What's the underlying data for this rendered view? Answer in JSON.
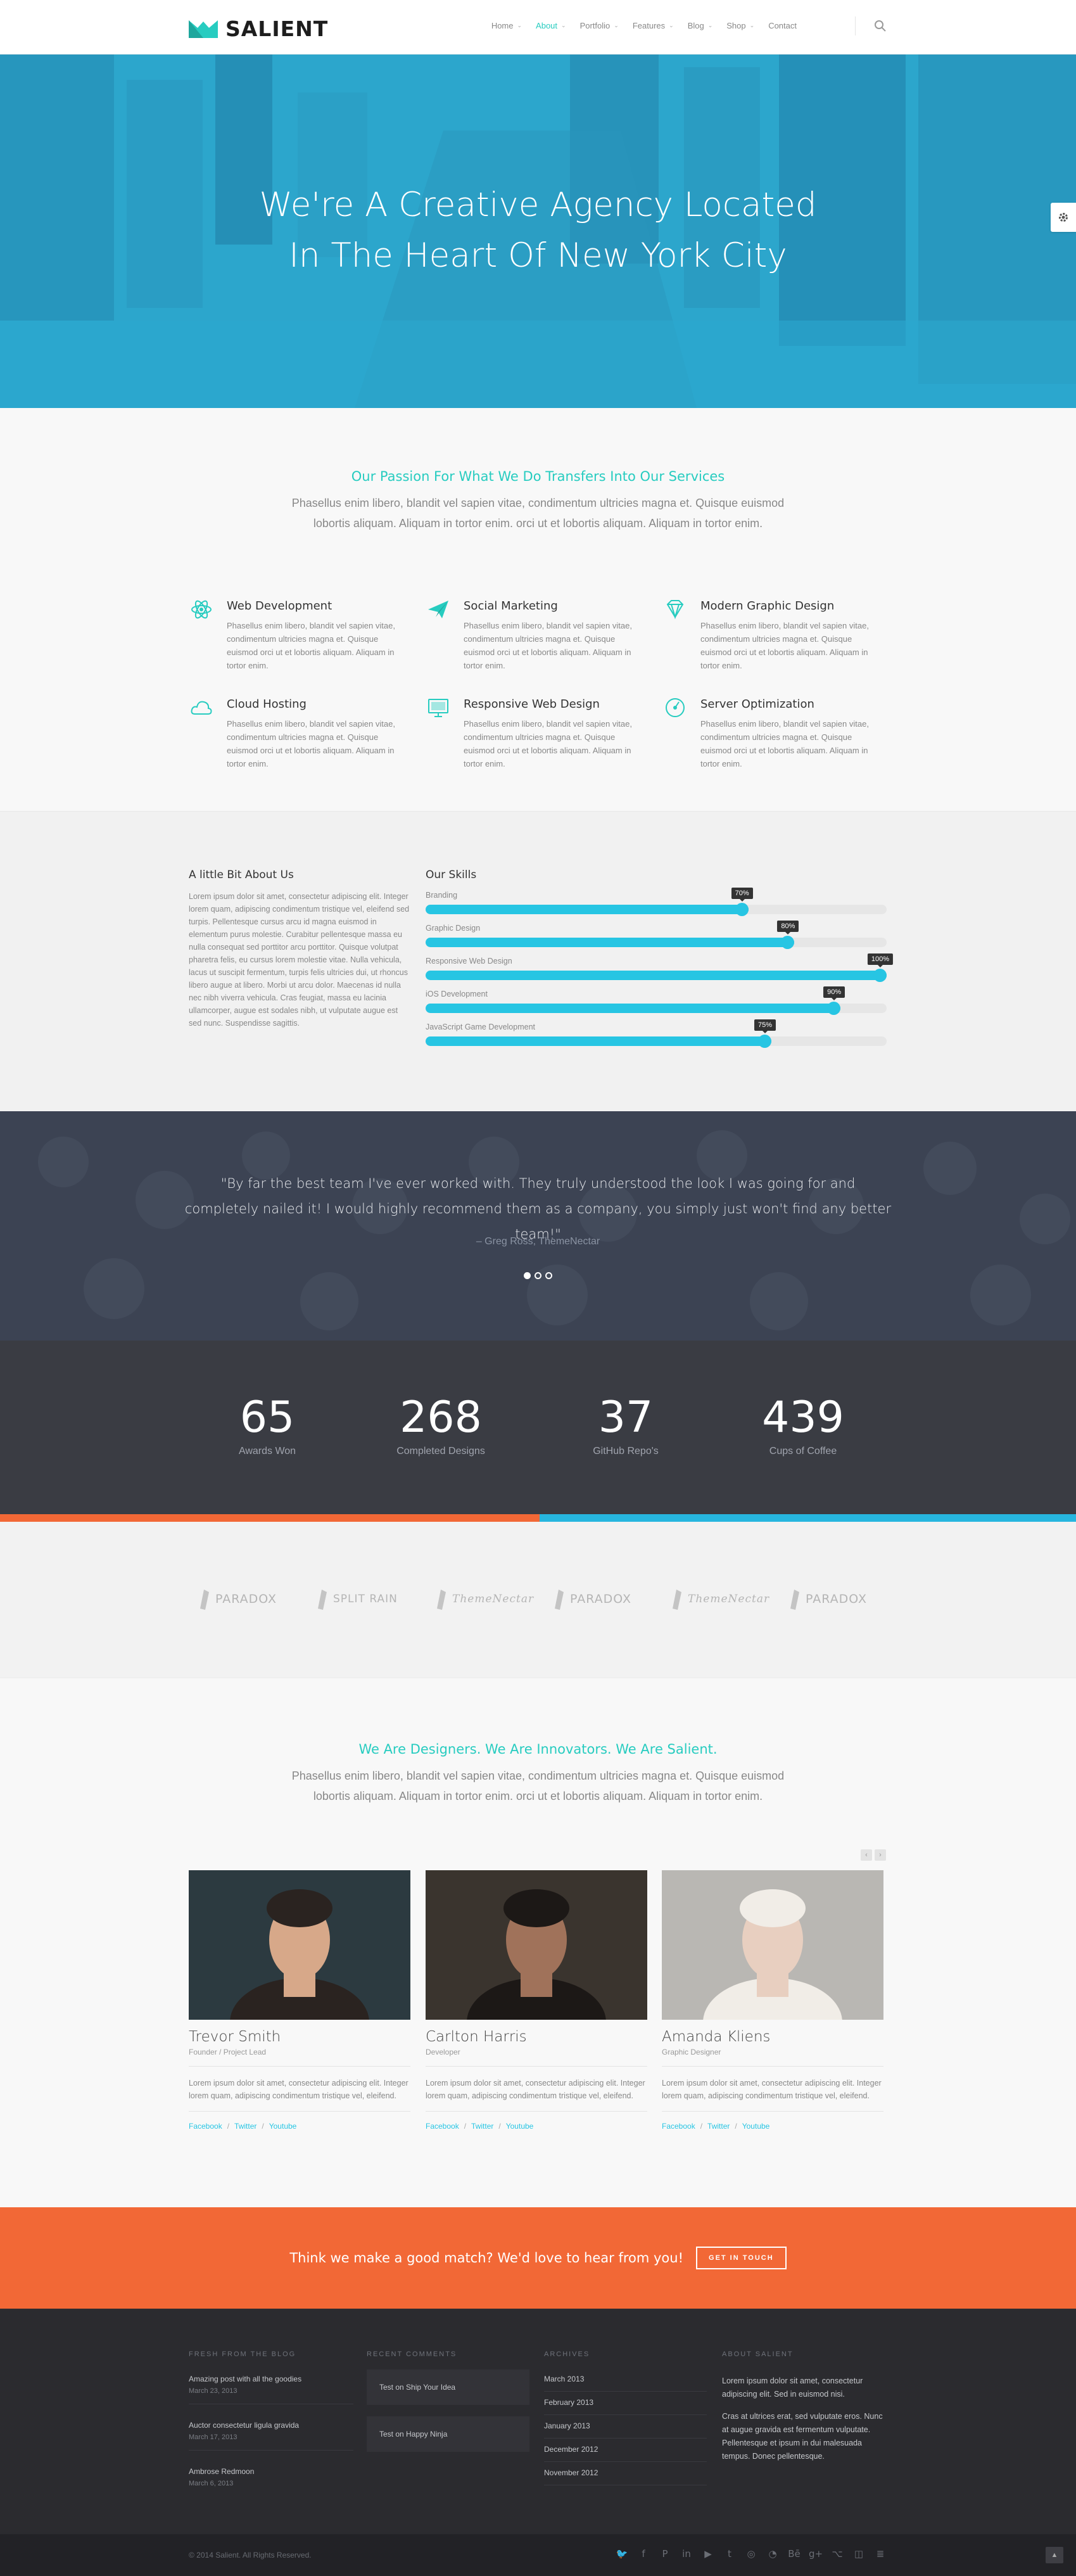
{
  "brand": {
    "name": "SALIENT",
    "accent": "#27ccc0",
    "blue": "#27c5e3",
    "orange": "#f26836"
  },
  "nav": {
    "items": [
      {
        "label": "Home",
        "has_menu": true
      },
      {
        "label": "About",
        "has_menu": true,
        "active": true
      },
      {
        "label": "Portfolio",
        "has_menu": true
      },
      {
        "label": "Features",
        "has_menu": true
      },
      {
        "label": "Blog",
        "has_menu": true
      },
      {
        "label": "Shop",
        "has_menu": true
      },
      {
        "label": "Contact",
        "has_menu": false
      }
    ],
    "search_icon": "search-icon"
  },
  "hero": {
    "line1": "We're A Creative Agency Located",
    "line2": "In The Heart Of New York City",
    "side_tab_icon": "gear-icon"
  },
  "services": {
    "heading": "Our Passion For What We Do Transfers Into Our Services",
    "subtext": "Phasellus enim libero, blandit vel sapien vitae, condimentum ultricies magna et. Quisque euismod lobortis aliquam. Aliquam in tortor enim. orci ut et lobortis aliquam. Aliquam in tortor enim.",
    "items": [
      {
        "title": "Web Development",
        "icon": "atom-icon",
        "text": "Phasellus enim libero, blandit vel sapien vitae, condimentum ultricies magna et. Quisque euismod orci ut et lobortis aliquam. Aliquam in tortor enim."
      },
      {
        "title": "Social Marketing",
        "icon": "paper-plane-icon",
        "text": "Phasellus enim libero, blandit vel sapien vitae, condimentum ultricies magna et. Quisque euismod orci ut et lobortis aliquam. Aliquam in tortor enim."
      },
      {
        "title": "Modern Graphic Design",
        "icon": "diamond-icon",
        "text": "Phasellus enim libero, blandit vel sapien vitae, condimentum ultricies magna et. Quisque euismod orci ut et lobortis aliquam. Aliquam in tortor enim."
      },
      {
        "title": "Cloud Hosting",
        "icon": "cloud-icon",
        "text": "Phasellus enim libero, blandit vel sapien vitae, condimentum ultricies magna et. Quisque euismod orci ut et lobortis aliquam. Aliquam in tortor enim."
      },
      {
        "title": "Responsive Web Design",
        "icon": "monitor-icon",
        "text": "Phasellus enim libero, blandit vel sapien vitae, condimentum ultricies magna et. Quisque euismod orci ut et lobortis aliquam. Aliquam in tortor enim."
      },
      {
        "title": "Server Optimization",
        "icon": "gauge-icon",
        "text": "Phasellus enim libero, blandit vel sapien vitae, condimentum ultricies magna et. Quisque euismod orci ut et lobortis aliquam. Aliquam in tortor enim."
      }
    ]
  },
  "about": {
    "heading": "A little Bit About Us",
    "text": "Lorem ipsum dolor sit amet, consectetur adipiscing elit. Integer lorem quam, adipiscing condimentum tristique vel, eleifend sed turpis. Pellentesque cursus arcu id magna euismod in elementum purus molestie. Curabitur pellentesque massa eu nulla consequat sed porttitor arcu porttitor. Quisque volutpat pharetra felis, eu cursus lorem molestie vitae. Nulla vehicula, lacus ut suscipit fermentum, turpis felis ultricies dui, ut rhoncus libero augue at libero. Morbi ut arcu dolor. Maecenas id nulla nec nibh viverra vehicula. Cras feugiat, massa eu lacinia ullamcorper, augue est sodales nibh, ut vulputate augue est sed nunc. Suspendisse sagittis."
  },
  "skills": {
    "heading": "Our Skills",
    "items": [
      {
        "label": "Branding",
        "percent": 70,
        "badge": "70%"
      },
      {
        "label": "Graphic Design",
        "percent": 80,
        "badge": "80%"
      },
      {
        "label": "Responsive Web Design",
        "percent": 100,
        "badge": "100%"
      },
      {
        "label": "iOS Development",
        "percent": 90,
        "badge": "90%"
      },
      {
        "label": "JavaScript Game Development",
        "percent": 75,
        "badge": "75%"
      }
    ]
  },
  "testimonial": {
    "quote": "\"By far the best team I've ever worked with. They truly understood the look I was going for and completely nailed it! I would highly recommend them as a company, you simply just won't find any better team!\"",
    "author": "– Greg Ross, ThemeNectar",
    "dots": 3,
    "active_dot": 0
  },
  "counters": [
    {
      "value": "65",
      "label": "Awards Won"
    },
    {
      "value": "268",
      "label": "Completed Designs"
    },
    {
      "value": "37",
      "label": "GitHub Repo's"
    },
    {
      "value": "439",
      "label": "Cups of Coffee"
    }
  ],
  "clients": [
    {
      "name": "PARADOX",
      "icon": "paradox-logo"
    },
    {
      "name": "SPLIT RAIN",
      "icon": "splitrain-logo"
    },
    {
      "name": "ThemeNectar",
      "icon": "themenectar-logo"
    },
    {
      "name": "PARADOX",
      "icon": "paradox-logo"
    },
    {
      "name": "ThemeNectar",
      "icon": "themenectar-logo"
    },
    {
      "name": "PARADOX",
      "icon": "paradox-logo"
    }
  ],
  "team": {
    "heading": "We Are Designers. We Are Innovators. We Are Salient.",
    "subtext": "Phasellus enim libero, blandit vel sapien vitae, condimentum ultricies magna et. Quisque euismod lobortis aliquam. Aliquam in tortor enim. orci ut et lobortis aliquam. Aliquam in tortor enim.",
    "members": [
      {
        "name": "Trevor Smith",
        "role": "Founder / Project Lead",
        "bio": "Lorem ipsum dolor sit amet, consectetur adipiscing elit. Integer lorem quam, adipiscing condimentum tristique vel, eleifend.",
        "links": [
          "Facebook",
          "Twitter",
          "Youtube"
        ]
      },
      {
        "name": "Carlton Harris",
        "role": "Developer",
        "bio": "Lorem ipsum dolor sit amet, consectetur adipiscing elit. Integer lorem quam, adipiscing condimentum tristique vel, eleifend.",
        "links": [
          "Facebook",
          "Twitter",
          "Youtube"
        ]
      },
      {
        "name": "Amanda Kliens",
        "role": "Graphic Designer",
        "bio": "Lorem ipsum dolor sit amet, consectetur adipiscing elit. Integer lorem quam, adipiscing condimentum tristique vel, eleifend.",
        "links": [
          "Facebook",
          "Twitter",
          "Youtube"
        ]
      }
    ],
    "link_separator": "/"
  },
  "cta": {
    "text": "Think we make a good match? We'd love to hear from you!",
    "button": "GET IN TOUCH"
  },
  "footer": {
    "blog": {
      "heading": "FRESH FROM THE BLOG",
      "posts": [
        {
          "title": "Amazing post with all the goodies",
          "date": "March 23, 2013"
        },
        {
          "title": "Auctor consectetur ligula gravida",
          "date": "March 17, 2013"
        },
        {
          "title": "Ambrose Redmoon",
          "date": "March 6, 2013"
        }
      ]
    },
    "comments": {
      "heading": "RECENT COMMENTS",
      "items": [
        "Test on Ship Your Idea",
        "Test on Happy Ninja"
      ]
    },
    "archives": {
      "heading": "ARCHIVES",
      "items": [
        "March 2013",
        "February 2013",
        "January 2013",
        "December 2012",
        "November 2012"
      ]
    },
    "about": {
      "heading": "ABOUT SALIENT",
      "p1": "Lorem ipsum dolor sit amet, consectetur adipiscing elit. Sed in euismod nisi.",
      "p2": "Cras at ultrices erat, sed vulputate eros. Nunc at augue gravida est fermentum vulputate. Pellentesque et ipsum in dui malesuada tempus. Donec pellentesque."
    }
  },
  "copyright": {
    "text": "© 2014 Salient. All Rights Reserved.",
    "socials": [
      "twitter-icon",
      "facebook-icon",
      "pinterest-icon",
      "linkedin-icon",
      "youtube-icon",
      "tumblr-icon",
      "dribbble-icon",
      "rss-icon",
      "behance-icon",
      "google-plus-icon",
      "github-icon",
      "instagram-icon",
      "stackexchange-icon"
    ],
    "back_to_top_icon": "chevron-up-icon"
  }
}
